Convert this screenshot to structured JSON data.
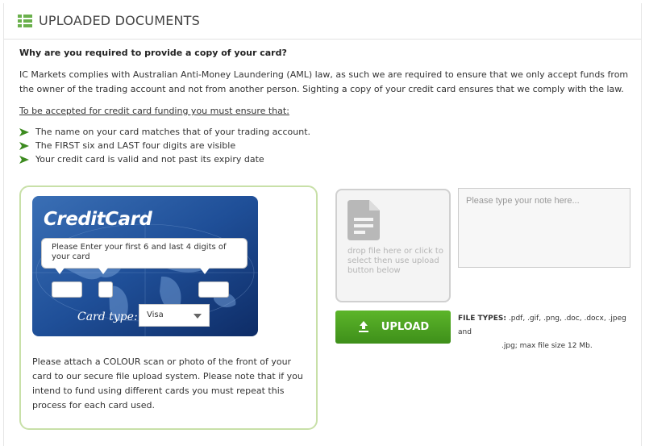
{
  "header": {
    "title": "UPLOADED DOCUMENTS",
    "icon": "list-icon",
    "icon_color": "#6ab04c"
  },
  "info": {
    "question": "Why are you required to provide a copy of your card?",
    "intro": "IC Markets complies with Australian Anti-Money Laundering (AML) law, as such we are required to ensure that we only accept funds from the owner of the trading account and not from another person. Sighting a copy of your credit card ensures that we comply with the law.",
    "requirements_heading": "To be accepted for credit card funding you must ensure that:",
    "requirements": [
      "The name on your card matches that of your trading account.",
      "The FIRST six and LAST four digits are visible",
      "Your credit card is valid and not past its expiry date"
    ],
    "bullet_color": "#3d8b20"
  },
  "card_panel": {
    "border_color": "#c8e0a8",
    "card_brand": "CreditCard",
    "tooltip": "Please Enter your first 6 and last 4 digits of your card",
    "card_type_label": "Card type:",
    "card_type_value": "Visa",
    "attach_text": "Please attach a COLOUR scan or photo of the front of your card to our secure file upload system. Please note that if you intend to fund using different cards you must repeat this process for each card used."
  },
  "upload": {
    "drop_text": "drop file here or click to select then use upload button below",
    "note_placeholder": "Please type your note here...",
    "note_value": "",
    "button_label": "UPLOAD",
    "button_color": "#4ea224",
    "file_types_label": "FILE TYPES:",
    "file_types_line1": ".pdf, .gif, .png, .doc, .docx, .jpeg and",
    "file_types_line2": ".jpg; max file size 12 Mb."
  }
}
